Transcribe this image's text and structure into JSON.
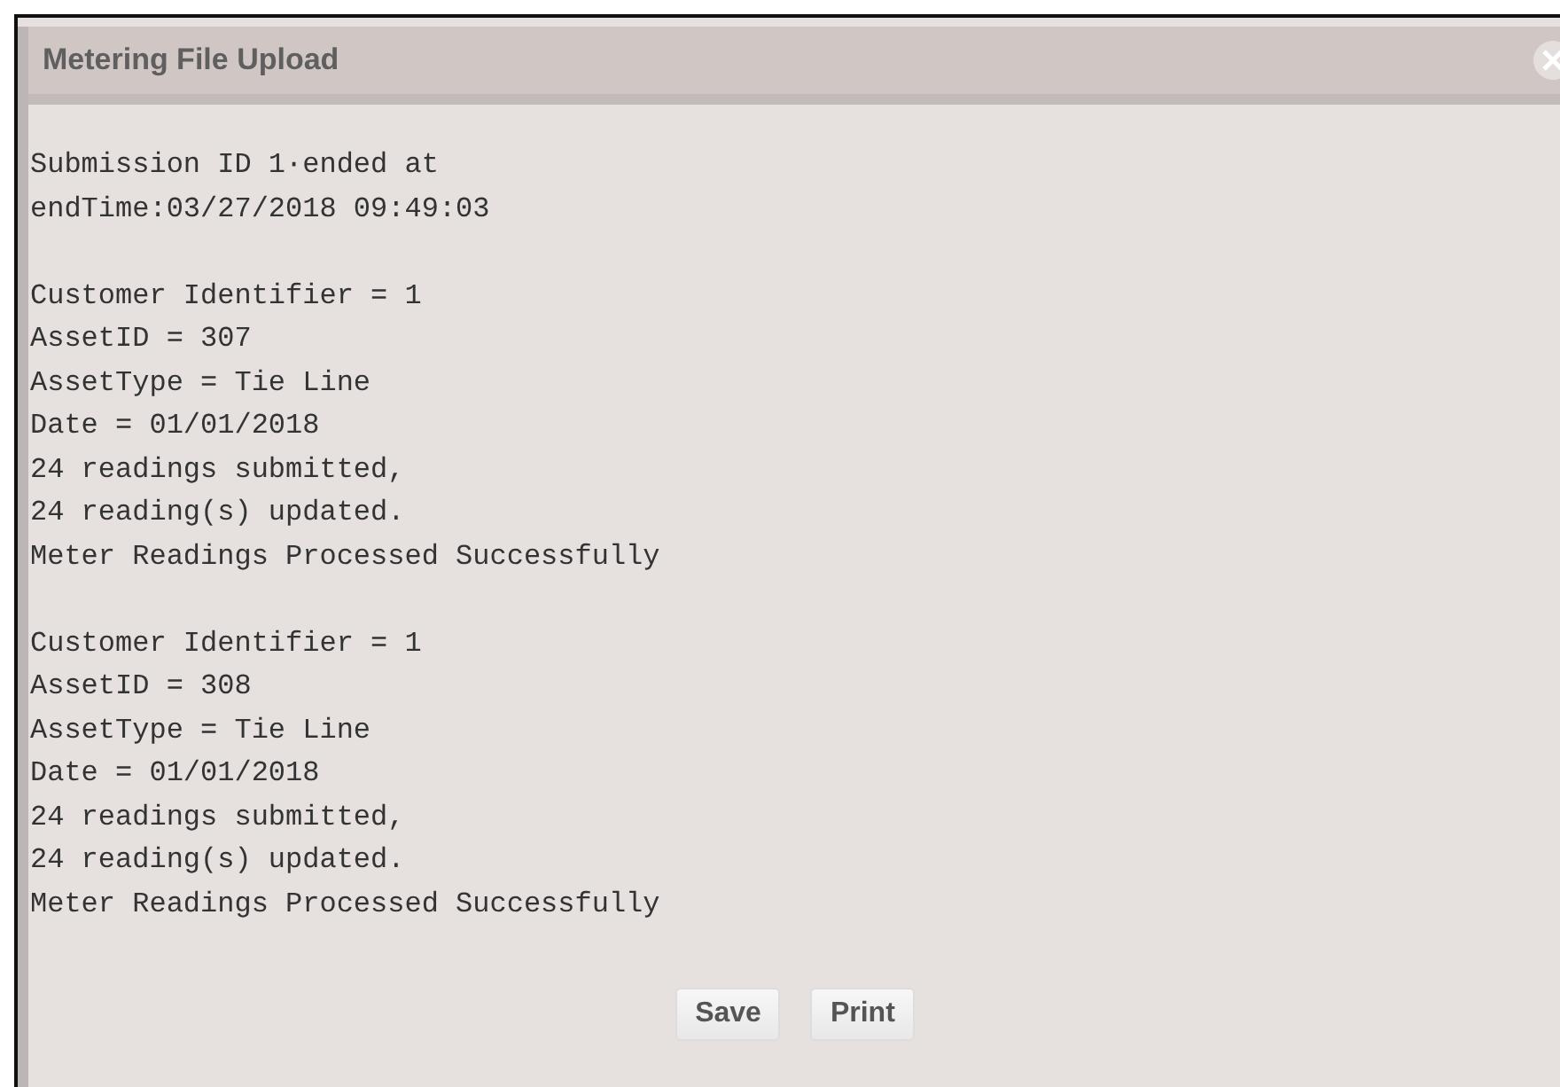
{
  "dialog": {
    "title": "Metering File Upload"
  },
  "blocks": [
    [
      "Submission ID 1·ended at",
      "endTime:03/27/2018 09:49:03"
    ],
    [
      "Customer Identifier = 1",
      "AssetID = 307",
      "AssetType = Tie Line",
      "Date = 01/01/2018",
      "24 readings submitted,",
      "24 reading(s) updated.",
      "Meter Readings Processed Successfully"
    ],
    [
      "Customer Identifier = 1",
      "AssetID = 308",
      "AssetType = Tie Line",
      "Date = 01/01/2018",
      "24 readings submitted,",
      "24 reading(s) updated.",
      "Meter Readings Processed Successfully"
    ]
  ],
  "buttons": [
    "Save",
    "Print"
  ]
}
